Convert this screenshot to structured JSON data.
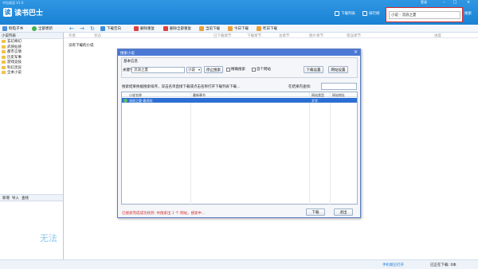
{
  "window": {
    "title": "书包阅读 V1.0",
    "login": "登录"
  },
  "app": {
    "logo_mark": "读",
    "logo_text": "读书巴士"
  },
  "system_buttons": {
    "min": "–",
    "max": "□",
    "close": "×"
  },
  "topnav": [
    {
      "label": "下载列表"
    },
    {
      "label": "排行榜"
    }
  ],
  "search": {
    "value": "小说 - 流浪之夏",
    "button": "搜索"
  },
  "toolbar": {
    "new_book": "制电子书",
    "update_all": "全部更新",
    "items": [
      "下载空白",
      "删除重复",
      "删除全部重复",
      "当前下载",
      "今日下载",
      "昨日下载"
    ]
  },
  "left_panel": {
    "header": "小说列表",
    "tree": [
      "玄幻奇幻",
      "武侠仙侠",
      "都市言情",
      "历史军事",
      "游戏竞技",
      "科幻灵异",
      "全本小说"
    ],
    "bottom": [
      "新增",
      "导入",
      "查找"
    ],
    "watermark": "无法"
  },
  "main": {
    "columns": [
      "作者",
      "状态",
      "已下载章节",
      "下载章节",
      "总章节",
      "图片章节",
      "错误章节",
      "进度"
    ],
    "empty_text": "没有下载的小说"
  },
  "status": {
    "left": "手机端已打开",
    "right": "已正在下载: 0本"
  },
  "dialog": {
    "title": "搜索小说",
    "close": "×",
    "group_label": "基本信息",
    "keyword_label": "关键字",
    "keyword_value": "流浪之夏",
    "type_value": "小说",
    "stop_button": "停止搜索",
    "exact_label": "精确搜索",
    "skip_label": "首个网站",
    "download_settings": "下载设置",
    "site_settings": "网站设置",
    "hint": "搜索结果依据搜索排序，双击名单直接下载或点击名称打开下载列表下载...",
    "filter_label": "在结果内查找:",
    "result_columns": [
      "小说名称",
      "最新章节",
      "网站类型",
      "网站地址"
    ],
    "result_row": {
      "name": "流浪之夏-春风吹",
      "chapter": "",
      "type": "文学",
      "site": ""
    },
    "status_text": "已搜索完成成功找到: 共搜索出 1 个 网站，搜索中...",
    "download_button": "下载",
    "exit_button": "退出"
  },
  "colors": {
    "titlebar": "#1a82d4",
    "accent": "#2c6fd2",
    "highlight": "#d32b2b"
  }
}
